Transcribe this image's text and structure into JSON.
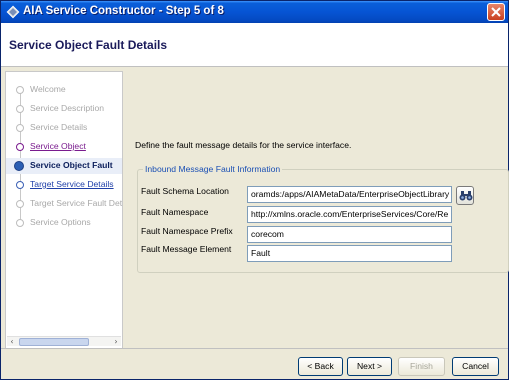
{
  "window": {
    "title": "AIA Service Constructor - Step 5 of 8"
  },
  "header": {
    "title": "Service Object Fault Details"
  },
  "nav": {
    "items": [
      {
        "label": "Welcome",
        "state": "disabled"
      },
      {
        "label": "Service Description",
        "state": "disabled"
      },
      {
        "label": "Service Details",
        "state": "disabled"
      },
      {
        "label": "Service Object",
        "state": "visited"
      },
      {
        "label": "Service Object Fault",
        "state": "current"
      },
      {
        "label": "Target Service Details",
        "state": "link"
      },
      {
        "label": "Target Service Fault Det",
        "state": "disabled"
      },
      {
        "label": "Service Options",
        "state": "disabled"
      }
    ]
  },
  "main": {
    "intro": "Define the fault message details for the service interface.",
    "group_title": "Inbound Message Fault Information",
    "fields": [
      {
        "label": "Fault Schema Location",
        "value": "oramds:/apps/AIAMetaData/EnterpriseObjectLibrary"
      },
      {
        "label": "Fault Namespace",
        "value": "http://xmlns.oracle.com/EnterpriseServices/Core/Re"
      },
      {
        "label": "Fault Namespace Prefix",
        "value": "corecom"
      },
      {
        "label": "Fault Message Element",
        "value": "Fault"
      }
    ]
  },
  "buttons": {
    "back": "< Back",
    "next": "Next >",
    "finish": "Finish",
    "cancel": "Cancel"
  }
}
